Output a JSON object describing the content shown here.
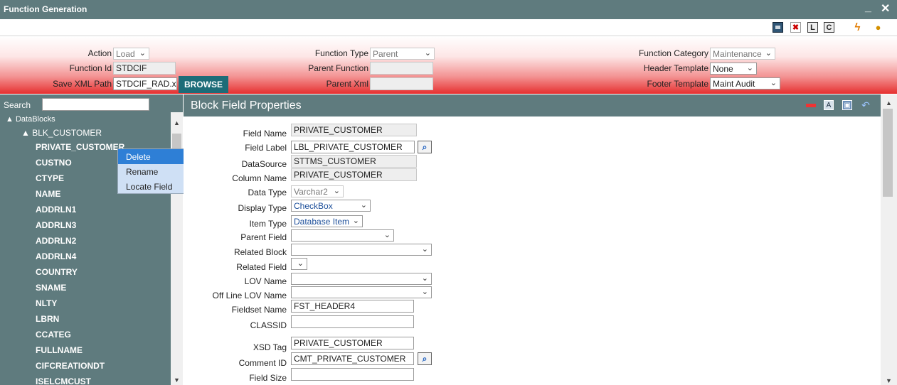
{
  "window": {
    "title": "Function Generation",
    "minimize": "_",
    "close": "✕"
  },
  "toolbar_icons": [
    "save-icon",
    "delete-icon",
    "l-icon",
    "c-icon",
    "flash-icon",
    "bell-icon"
  ],
  "toolbar_labels": {
    "l": "L",
    "c": "C"
  },
  "form": {
    "action_label": "Action",
    "action_value": "Load",
    "function_id_label": "Function Id",
    "function_id_value": "STDCIF",
    "save_xml_label": "Save XML Path",
    "save_xml_value": "STDCIF_RAD.xml",
    "browse_label": "BROWSE",
    "function_type_label": "Function Type",
    "function_type_value": "Parent",
    "parent_function_label": "Parent Function",
    "parent_function_value": "",
    "parent_xml_label": "Parent Xml",
    "parent_xml_value": "",
    "function_category_label": "Function Category",
    "function_category_value": "Maintenance",
    "header_template_label": "Header Template",
    "header_template_value": "None",
    "footer_template_label": "Footer Template",
    "footer_template_value": "Maint Audit"
  },
  "sidebar": {
    "search_label": "Search",
    "root": "DataBlocks",
    "block": "BLK_CUSTOMER",
    "items": [
      "PRIVATE_CUSTOMER",
      "CUSTNO",
      "CTYPE",
      "NAME",
      "ADDRLN1",
      "ADDRLN3",
      "ADDRLN2",
      "ADDRLN4",
      "COUNTRY",
      "SNAME",
      "NLTY",
      "LBRN",
      "CCATEG",
      "FULLNAME",
      "CIFCREATIONDT",
      "ISELCMCUST"
    ]
  },
  "context_menu": {
    "items": [
      "Delete",
      "Rename",
      "Locate Field"
    ],
    "active": "Delete"
  },
  "panel": {
    "title": "Block Field Properties",
    "fields": {
      "field_name_label": "Field Name",
      "field_name_value": "PRIVATE_CUSTOMER",
      "field_label_label": "Field Label",
      "field_label_value": "LBL_PRIVATE_CUSTOMER",
      "datasource_label": "DataSource",
      "datasource_value": "STTMS_CUSTOMER",
      "column_name_label": "Column Name",
      "column_name_value": "PRIVATE_CUSTOMER",
      "data_type_label": "Data Type",
      "data_type_value": "Varchar2",
      "display_type_label": "Display Type",
      "display_type_value": "CheckBox",
      "item_type_label": "Item Type",
      "item_type_value": "Database Item",
      "parent_field_label": "Parent Field",
      "parent_field_value": "",
      "related_block_label": "Related Block",
      "related_block_value": "",
      "related_field_label": "Related Field",
      "related_field_value": "",
      "lov_name_label": "LOV Name",
      "lov_name_value": "",
      "offline_lov_label": "Off Line LOV Name",
      "offline_lov_value": "",
      "fieldset_name_label": "Fieldset Name",
      "fieldset_name_value": "FST_HEADER4",
      "classid_label": "CLASSID",
      "classid_value": "",
      "xsd_tag_label": "XSD Tag",
      "xsd_tag_value": "PRIVATE_CUSTOMER",
      "comment_id_label": "Comment ID",
      "comment_id_value": "CMT_PRIVATE_CUSTOMER",
      "field_size_label": "Field Size",
      "field_size_value": ""
    }
  },
  "colors": {
    "panel_bg": "#5f7b7e",
    "accent": "#1d6c78",
    "menu_active": "#2e7fd6"
  }
}
